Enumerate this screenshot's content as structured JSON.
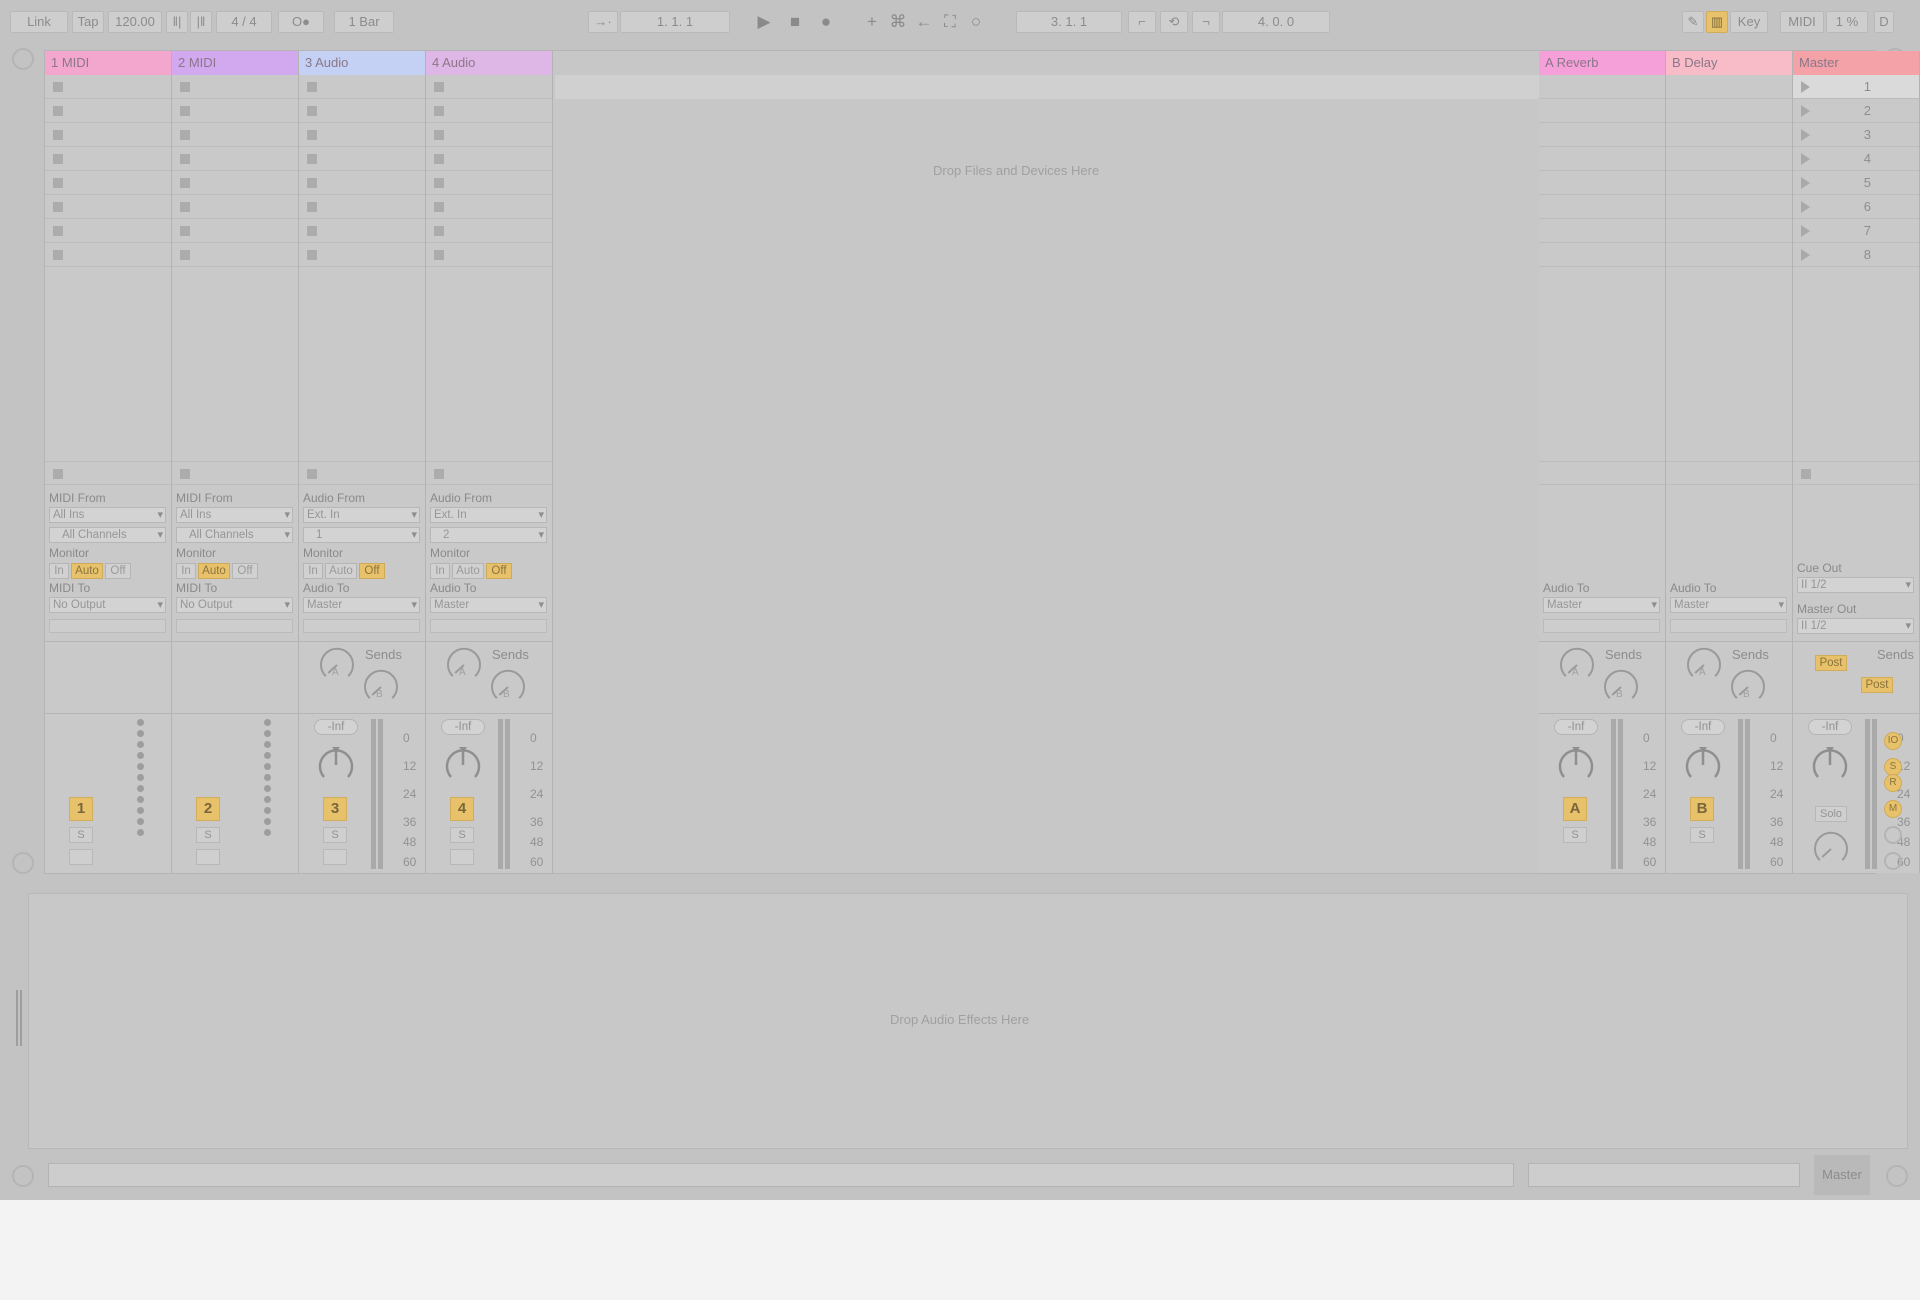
{
  "toolbar": {
    "link": "Link",
    "tap": "Tap",
    "tempo": "120.00",
    "time_signature": "4  /  4",
    "metronome": "O●",
    "quantize": "1 Bar",
    "arrangement_position": "1.   1.   1",
    "loop_start": "3.   1.   1",
    "loop_length": "4.   0.   0",
    "key": "Key",
    "midi": "MIDI",
    "cpu": "1 %",
    "d": "D"
  },
  "tracks": [
    {
      "name": "1 MIDI",
      "color": "#f3a7cf",
      "type": "midi",
      "from_label": "MIDI From",
      "from_value": "All Ins",
      "channel_value": "All Channels",
      "monitor_label": "Monitor",
      "monitor_in": "In",
      "monitor_auto": "Auto",
      "monitor_off": "Off",
      "monitor_active": "Auto",
      "to_label": "MIDI To",
      "to_value": "No Output",
      "number": "1",
      "solo": "S"
    },
    {
      "name": "2 MIDI",
      "color": "#d2a8ee",
      "type": "midi",
      "from_label": "MIDI From",
      "from_value": "All Ins",
      "channel_value": "All Channels",
      "monitor_label": "Monitor",
      "monitor_in": "In",
      "monitor_auto": "Auto",
      "monitor_off": "Off",
      "monitor_active": "Auto",
      "to_label": "MIDI To",
      "to_value": "No Output",
      "number": "2",
      "solo": "S"
    },
    {
      "name": "3 Audio",
      "color": "#c4d0f4",
      "type": "audio",
      "from_label": "Audio From",
      "from_value": "Ext. In",
      "channel_value": "1",
      "monitor_label": "Monitor",
      "monitor_in": "In",
      "monitor_auto": "Auto",
      "monitor_off": "Off",
      "monitor_active": "Off",
      "to_label": "Audio To",
      "to_value": "Master",
      "number": "3",
      "solo": "S",
      "sends_label": "Sends",
      "volume": "-Inf"
    },
    {
      "name": "4 Audio",
      "color": "#dfb7e6",
      "type": "audio",
      "from_label": "Audio From",
      "from_value": "Ext. In",
      "channel_value": "2",
      "monitor_label": "Monitor",
      "monitor_in": "In",
      "monitor_auto": "Auto",
      "monitor_off": "Off",
      "monitor_active": "Off",
      "to_label": "Audio To",
      "to_value": "Master",
      "number": "4",
      "solo": "S",
      "sends_label": "Sends",
      "volume": "-Inf"
    }
  ],
  "returns": [
    {
      "name": "A Reverb",
      "color": "#f6a0da",
      "to_label": "Audio To",
      "to_value": "Master",
      "sends_label": "Sends",
      "volume": "-Inf",
      "letter": "A",
      "solo": "S"
    },
    {
      "name": "B Delay",
      "color": "#f7bcc8",
      "to_label": "Audio To",
      "to_value": "Master",
      "sends_label": "Sends",
      "volume": "-Inf",
      "letter": "B",
      "solo": "S"
    }
  ],
  "master": {
    "name": "Master",
    "color": "#f4a1a7",
    "scenes": [
      "1",
      "2",
      "3",
      "4",
      "5",
      "6",
      "7",
      "8"
    ],
    "cue_out_label": "Cue Out",
    "cue_out_value": "II 1/2",
    "master_out_label": "Master Out",
    "master_out_value": "II 1/2",
    "sends_label": "Sends",
    "post1": "Post",
    "post2": "Post",
    "volume": "-Inf",
    "solo": "Solo"
  },
  "send_letters": {
    "a": "A",
    "b": "B"
  },
  "db_scale": [
    "0",
    "12",
    "24",
    "36",
    "48",
    "60"
  ],
  "drop_files": "Drop Files and Devices Here",
  "drop_effects": "Drop Audio Effects Here",
  "status": {
    "master": "Master"
  }
}
